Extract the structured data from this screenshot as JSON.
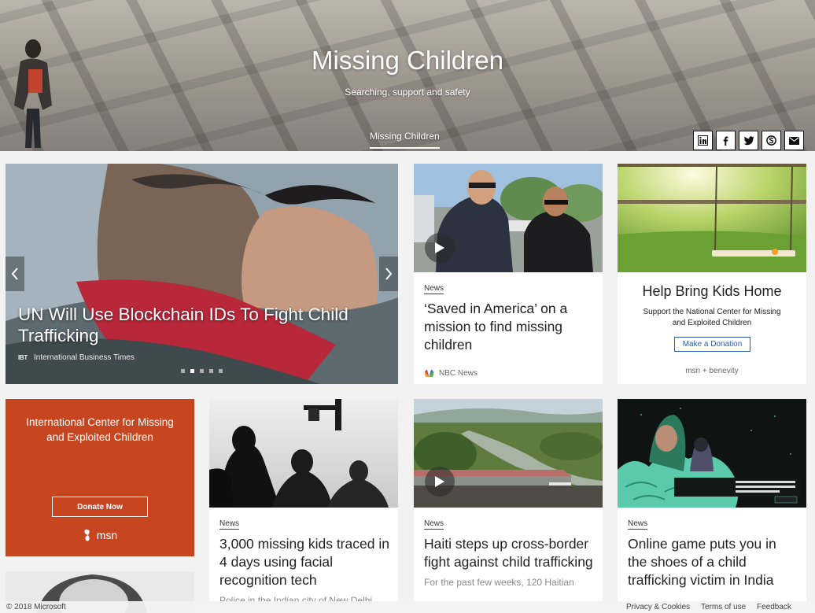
{
  "hero": {
    "title": "Missing Children",
    "subtitle": "Searching, support and safety",
    "tab_label": "Missing Children",
    "share_icons": [
      "linkedin-icon",
      "facebook-icon",
      "twitter-icon",
      "skype-icon",
      "mail-icon"
    ]
  },
  "main_story": {
    "title": "UN Will Use Blockchain IDs To Fight Child Trafficking",
    "source_logo": "IBT",
    "source": "International Business Times",
    "carousel_count": 5,
    "carousel_active": 2
  },
  "card_video": {
    "tag": "News",
    "title": "‘Saved in America’ on a mission to find missing children",
    "source": "NBC News"
  },
  "card_donate": {
    "title": "Help Bring Kids Home",
    "desc": "Support the National Center for Missing and Exploited Children",
    "button": "Make a Donation",
    "footer": "msn + benevity"
  },
  "card_icmec": {
    "title": "International Center for Missing and Exploited Children",
    "button": "Donate Now",
    "logo_text": "msn",
    "bg_color": "#c8461f"
  },
  "card_facial": {
    "tag": "News",
    "title": "3,000 missing kids traced in 4 days using facial recognition tech",
    "snippet": "Police in the Indian city of New Delhi"
  },
  "card_haiti": {
    "tag": "News",
    "title": "Haiti steps up cross-border fight against child trafficking",
    "snippet": "For the past few weeks, 120 Haitian"
  },
  "card_game": {
    "tag": "News",
    "title": "Online game puts you in the shoes of a child trafficking victim in India"
  },
  "footer": {
    "copyright": "© 2018 Microsoft",
    "privacy": "Privacy & Cookies",
    "terms": "Terms of use",
    "feedback": "Feedback"
  }
}
